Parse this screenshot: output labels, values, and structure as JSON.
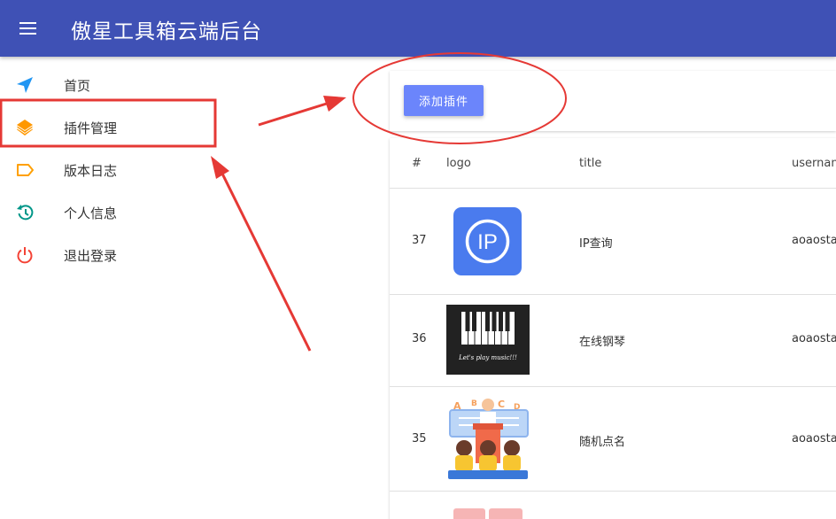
{
  "header": {
    "title": "傲星工具箱云端后台",
    "menu_icon": "hamburger-icon"
  },
  "sidebar": {
    "items": [
      {
        "label": "首页",
        "icon": "navigation-arrow-icon",
        "color": "#2196f3"
      },
      {
        "label": "插件管理",
        "icon": "layers-icon",
        "color": "#ff9800"
      },
      {
        "label": "版本日志",
        "icon": "label-tag-icon",
        "color": "#ffa000"
      },
      {
        "label": "个人信息",
        "icon": "history-icon",
        "color": "#009688"
      },
      {
        "label": "退出登录",
        "icon": "power-icon",
        "color": "#f44336"
      }
    ]
  },
  "toolbar": {
    "add_label": "添加插件"
  },
  "table": {
    "headers": [
      "#",
      "logo",
      "title",
      "usernan"
    ],
    "rows": [
      {
        "id": "37",
        "title": "IP查询",
        "username": "aoaosta",
        "logo": "ip-logo",
        "logo_text": "IP"
      },
      {
        "id": "36",
        "title": "在线钢琴",
        "username": "aoaosta",
        "logo": "piano-logo",
        "logo_text": "Let's play music!!!"
      },
      {
        "id": "35",
        "title": "随机点名",
        "username": "aoaosta",
        "logo": "classroom-logo"
      }
    ]
  },
  "colors": {
    "appbar": "#3f51b5",
    "add_button": "#6b85fb",
    "annotation": "#e53935"
  }
}
